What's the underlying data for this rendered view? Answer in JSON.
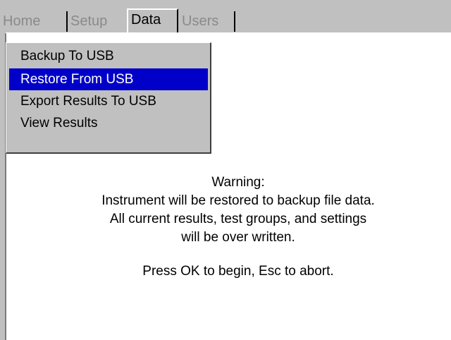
{
  "tabs": [
    {
      "label": "Home",
      "active": false
    },
    {
      "label": "Setup",
      "active": false
    },
    {
      "label": "Data",
      "active": true
    },
    {
      "label": "Users",
      "active": false
    }
  ],
  "menu": {
    "items": [
      {
        "label": "Backup To USB",
        "selected": false
      },
      {
        "label": "Restore From USB",
        "selected": true
      },
      {
        "label": "Export Results To USB",
        "selected": false
      },
      {
        "label": "View Results",
        "selected": false
      }
    ]
  },
  "message": {
    "title": "Warning:",
    "line1": "Instrument will be restored to backup file data.",
    "line2": "All current results, test groups, and settings",
    "line3": "will be over written.",
    "prompt": "Press OK to begin, Esc to abort."
  },
  "colors": {
    "chrome": "#c0c0c0",
    "selection": "#0000c8",
    "inactive_tab_text": "#8a8a8a"
  }
}
